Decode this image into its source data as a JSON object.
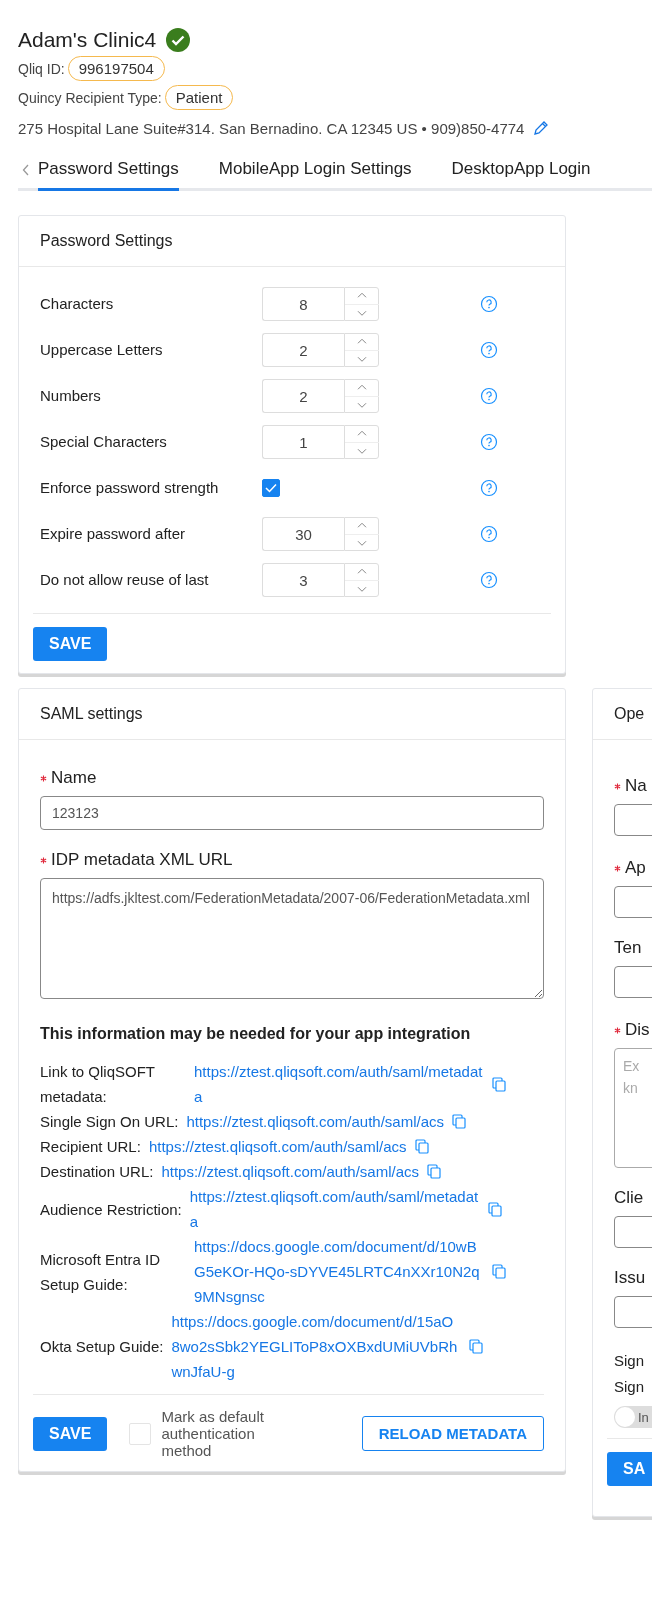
{
  "header": {
    "title": "Adam's Clinic4",
    "verified": true,
    "qliq_id_label": "Qliq ID:",
    "qliq_id": "996197504",
    "recipient_type_label": "Quincy Recipient Type:",
    "recipient_type": "Patient",
    "address": "275 Hospital Lane Suite#314. San Bernadino. CA 12345 US • 909)850-4774"
  },
  "tabs": [
    {
      "label": "Password Settings",
      "selected": true
    },
    {
      "label": "MobileApp Login Settings",
      "selected": false
    },
    {
      "label": "DesktopApp Login",
      "selected": false
    }
  ],
  "password_settings": {
    "title": "Password Settings",
    "rows": [
      {
        "kind": "number",
        "label": "Characters",
        "value": "8"
      },
      {
        "kind": "number",
        "label": "Uppercase Letters",
        "value": "2"
      },
      {
        "kind": "number",
        "label": "Numbers",
        "value": "2"
      },
      {
        "kind": "number",
        "label": "Special Characters",
        "value": "1"
      },
      {
        "kind": "checkbox",
        "label": "Enforce password strength",
        "checked": true
      },
      {
        "kind": "number",
        "label": "Expire password after",
        "value": "30"
      },
      {
        "kind": "number",
        "label": "Do not allow reuse of last",
        "value": "3"
      }
    ],
    "save": "SAVE"
  },
  "saml": {
    "title": "SAML settings",
    "name_required": true,
    "idp_required": true,
    "name_label": "Name",
    "name_value": "123123",
    "idp_label": "IDP metadata XML URL",
    "idp_value": "https://adfs.jkltest.com/FederationMetadata/2007-06/FederationMetadata.xml",
    "info_heading": "This information may be needed for your app integration",
    "links": [
      {
        "label": "Link to QliqSOFT metadata:",
        "url": "https://ztest.qliqsoft.com/auth/saml/metadata"
      },
      {
        "label": "Single Sign On URL:",
        "url": "https://ztest.qliqsoft.com/auth/saml/acs"
      },
      {
        "label": "Recipient URL:",
        "url": "https://ztest.qliqsoft.com/auth/saml/acs"
      },
      {
        "label": "Destination URL:",
        "url": "https://ztest.qliqsoft.com/auth/saml/acs"
      },
      {
        "label": "Audience Restriction:",
        "url": "https://ztest.qliqsoft.com/auth/saml/metadata"
      },
      {
        "label": "Microsoft Entra ID Setup Guide:",
        "url": "https://docs.google.com/document/d/10wBG5eKOr-HQo-sDYVE45LRTC4nXXr10N2q9MNsgnsc"
      },
      {
        "label": "Okta Setup Guide:",
        "url": "https://docs.google.com/document/d/15aO8wo2sSbk2YEGLIToP8xOXBxdUMiUVbRhwnJfaU-g"
      }
    ],
    "save": "SAVE",
    "default_label": "Mark as default authentication method",
    "default_checked": false,
    "reload": "RELOAD METADATA"
  },
  "openid": {
    "title": "Ope",
    "fields": [
      {
        "kind": "input",
        "label": "Na",
        "required": true
      },
      {
        "kind": "input",
        "label": "Ap",
        "required": true
      },
      {
        "kind": "input",
        "label": "Ten",
        "required": false
      },
      {
        "kind": "textarea",
        "label": "Dis",
        "required": true,
        "placeholder": "Ex kn"
      },
      {
        "kind": "input",
        "label": "Clie",
        "required": false
      },
      {
        "kind": "input",
        "label": "Issu",
        "required": false
      }
    ],
    "sign_lines": [
      "Sign",
      "Sign"
    ],
    "toggle": {
      "label": "In",
      "on": false
    },
    "save": "SA"
  }
}
